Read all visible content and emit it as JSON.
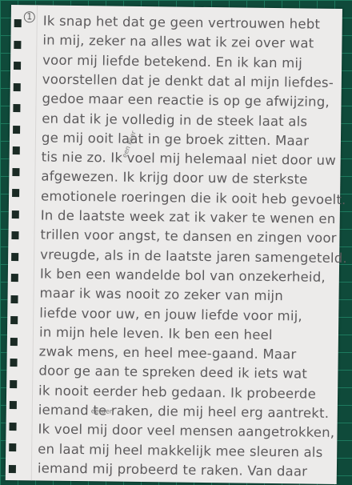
{
  "page_number": "1",
  "lines": [
    "Ik snap het dat ge geen vertrouwen hebt",
    "in mij, zeker na alles wat ik zei over wat",
    "voor mij liefde betekend. En ik kan mij",
    "voorstellen dat je denkt dat al mijn liefdes-",
    "gedoe maar een reactie is op ge afwijzing,",
    "en dat ik je volledig in de steek laat als",
    "ge mij ooit laat in ge broek zitten. Maar",
    "tis nie zo. Ik voel mij helemaal niet door uw",
    "afgewezen. Ik krijg door uw de sterkste",
    "emotionele roeringen die ik ooit heb gevoelt.",
    "In de laatste week zat ik vaker te wenen en",
    "trillen voor angst, te dansen en zingen voor",
    "vreugde, als in de laatste jaren samengeteld.",
    "Ik ben een wandelde bol van onzekerheid,",
    "maar ik was nooit zo zeker van mijn",
    "liefde voor uw, en jouw liefde voor mij,",
    "in mijn hele leven. Ik ben een heel",
    "zwak mens, en heel mee-gaand. Maar",
    "door ge aan te spreken deed ik iets wat",
    "ik nooit eerder heb gedaan. Ik probeerde",
    "iemand te raken, die mij heel erg aantrekt.",
    "Ik voel mij door veel mensen aangetrokken,",
    "en laat mij heel makkelijk mee sleuren als",
    "iemand mij probeerd te raken. Van daar"
  ],
  "insertions": {
    "ooit": "een keer",
    "nooit": "eerder"
  }
}
